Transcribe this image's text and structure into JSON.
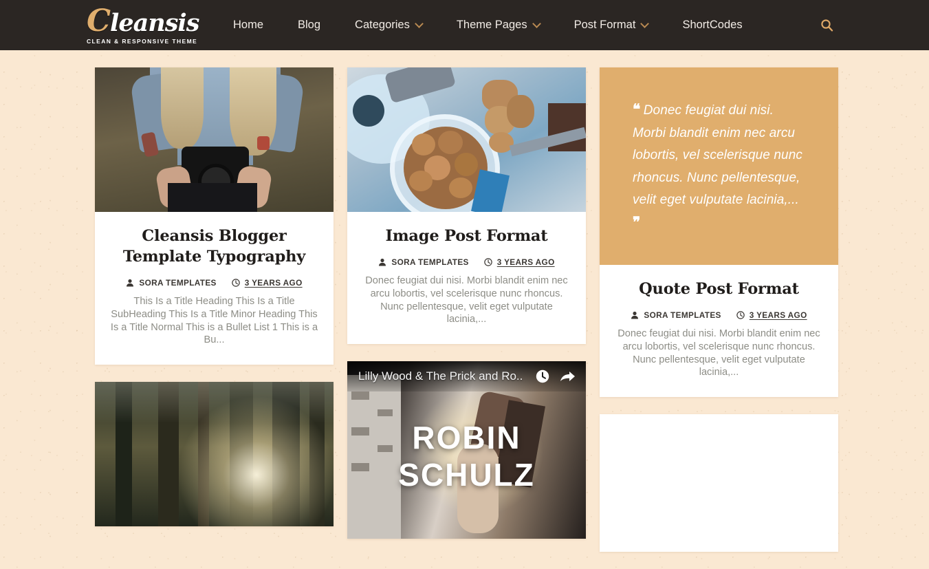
{
  "header": {
    "logo": {
      "cap": "C",
      "rest": "leansis",
      "tagline": "CLEAN & RESPONSIVE THEME"
    },
    "nav": [
      {
        "label": "Home",
        "caret": false,
        "icon": ""
      },
      {
        "label": "Blog",
        "caret": false,
        "icon": ""
      },
      {
        "label": "Categories",
        "caret": true,
        "icon": "chevron-down-icon"
      },
      {
        "label": "Theme Pages",
        "caret": true,
        "icon": "chevron-down-icon"
      },
      {
        "label": "Post Format",
        "caret": true,
        "icon": "chevron-down-icon"
      },
      {
        "label": "ShortCodes",
        "caret": false,
        "icon": ""
      }
    ],
    "search_icon": "search-icon",
    "colors": {
      "bar": "#2b2623",
      "accent": "#e0ae6d",
      "caret": "#b98a52"
    }
  },
  "meta_labels": {
    "author_icon": "user-icon",
    "time_icon": "clock-icon"
  },
  "posts": {
    "typography": {
      "image": "woman-holding-camera-photo",
      "title": "Cleansis Blogger Template Typography",
      "author": "SORA TEMPLATES",
      "date": "3 YEARS AGO",
      "excerpt": "This Is a Title Heading This Is a Title SubHeading This Is a Title Minor Heading This Is a Title Normal This is a Bullet List 1 This is a Bu..."
    },
    "forest": {
      "image": "forest-sunlight-photo"
    },
    "image_post": {
      "image": "walnuts-in-bowl-photo",
      "title": "Image Post Format",
      "author": "SORA TEMPLATES",
      "date": "3 YEARS AGO",
      "excerpt": "Donec feugiat dui nisi. Morbi blandit enim nec arcu lobortis, vel scelerisque nunc rhoncus. Nunc pellentesque, velit eget vulputate lacinia,..."
    },
    "video_post": {
      "yt_title": "Lilly Wood & The Prick and Ro..",
      "yt_overlay_text": "ROBIN SCHULZ",
      "watch_later_icon": "clock-icon",
      "share_icon": "share-arrow-icon"
    },
    "quote_post": {
      "quote": "Donec feugiat dui nisi. Morbi blandit enim nec arcu lobortis, vel scelerisque nunc rhoncus. Nunc pellentesque, velit eget vulputate lacinia,...",
      "open_quote": "❝",
      "close_quote": "❞",
      "title": "Quote Post Format",
      "author": "SORA TEMPLATES",
      "date": "3 YEARS AGO",
      "excerpt": "Donec feugiat dui nisi. Morbi blandit enim nec arcu lobortis, vel scelerisque nunc rhoncus. Nunc pellentesque, velit eget vulputate lacinia,...",
      "bg": "#e0ae6d"
    }
  },
  "page": {
    "bg": "#fae8d2",
    "card_bg": "#ffffff"
  }
}
